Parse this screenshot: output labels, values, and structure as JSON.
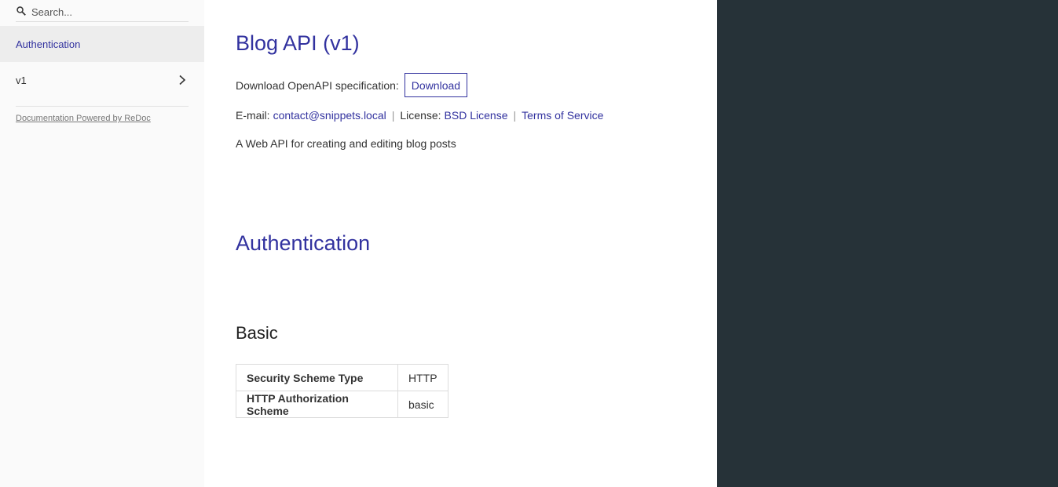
{
  "sidebar": {
    "search_placeholder": "Search...",
    "items": [
      {
        "label": "Authentication"
      },
      {
        "label": "v1"
      }
    ],
    "powered_by": "Documentation Powered by ReDoc"
  },
  "main": {
    "title": "Blog API (v1)",
    "download_label": "Download OpenAPI specification:",
    "download_button": "Download",
    "email_label": "E-mail:",
    "email": "contact@snippets.local",
    "license_label": "License:",
    "license": "BSD License",
    "terms": "Terms of Service",
    "description": "A Web API for creating and editing blog posts",
    "auth_heading": "Authentication",
    "scheme_heading": "Basic",
    "scheme_table": [
      {
        "key": "Security Scheme Type",
        "value": "HTTP"
      },
      {
        "key": "HTTP Authorization Scheme",
        "value": "basic"
      }
    ]
  },
  "colors": {
    "accent": "#32329f",
    "sidebar_bg": "#fafafa",
    "sidebar_active_bg": "#ededed",
    "right_panel_bg": "#263238"
  }
}
